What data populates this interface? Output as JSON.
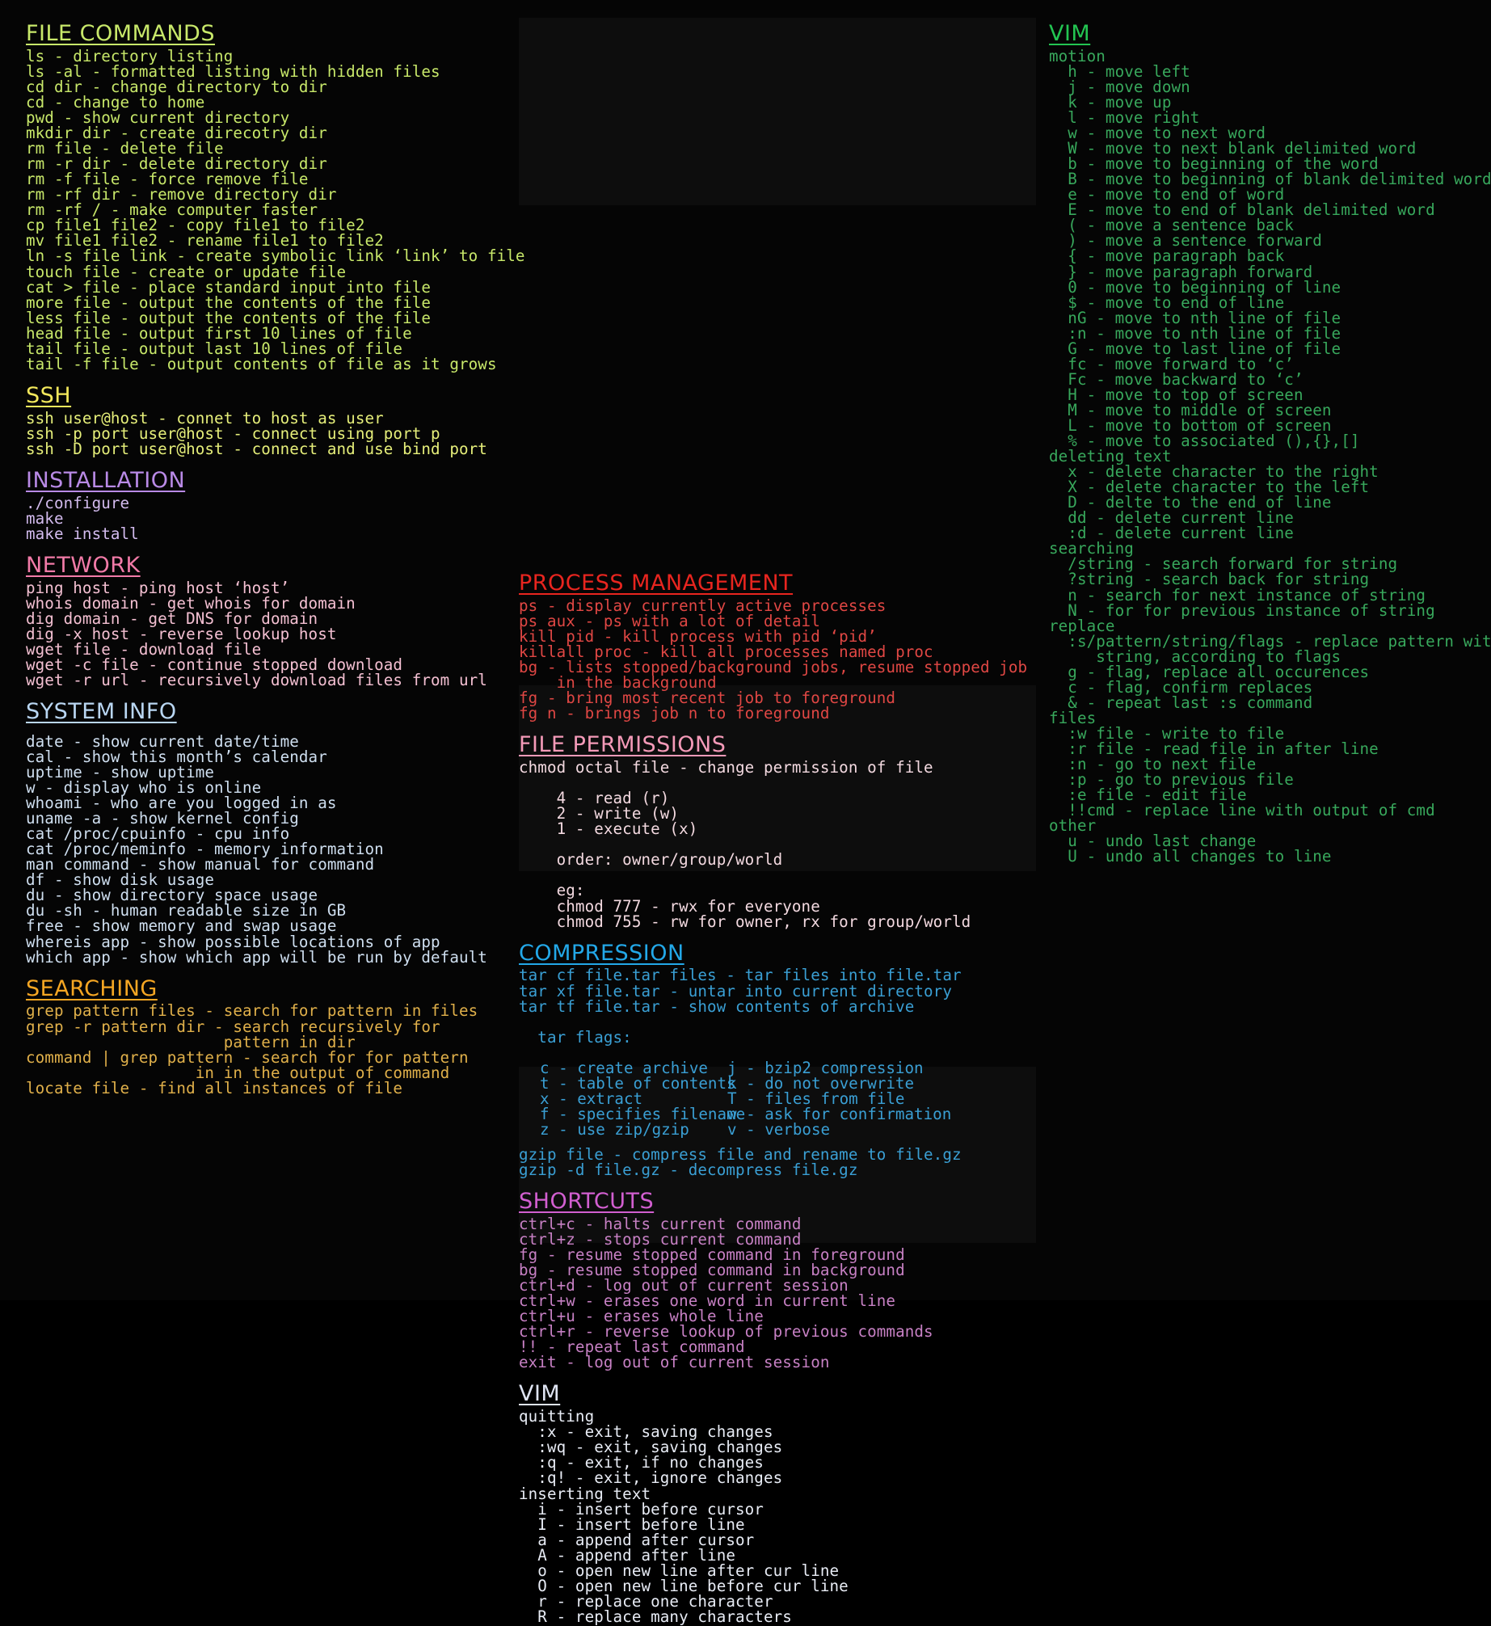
{
  "theme": {
    "background": "#050505",
    "file_commands": "#c8e86a",
    "ssh": "#f2e85c",
    "installation": "#b98ae6",
    "network": "#f27ba8",
    "system_info": "#b9d6f2",
    "searching": "#f5a623",
    "process_management": "#e8251f",
    "file_permissions": "#f49ab8",
    "compression": "#23a8e8",
    "shortcuts": "#d25fd0",
    "vim_col2": "#dfe4f2",
    "vim_col3": "#23c552"
  },
  "column1": {
    "file_commands": {
      "title": "FILE COMMANDS",
      "lines": [
        "ls - directory listing",
        "ls -al - formatted listing with hidden files",
        "cd dir - change directory to dir",
        "cd - change to home",
        "pwd - show current directory",
        "mkdir dir - create direcotry dir",
        "rm file - delete file",
        "rm -r dir - delete directory dir",
        "rm -f file - force remove file",
        "rm -rf dir - remove directory dir",
        "rm -rf / - make computer faster",
        "cp file1 file2 - copy file1 to file2",
        "mv file1 file2 - rename file1 to file2",
        "ln -s file link - create symbolic link ‘link’ to file",
        "touch file - create or update file",
        "cat > file - place standard input into file",
        "more file - output the contents of the file",
        "less file - output the contents of the file",
        "head file - output first 10 lines of file",
        "tail file - output last 10 lines of file",
        "tail -f file - output contents of file as it grows"
      ]
    },
    "ssh": {
      "title": "SSH",
      "lines": [
        "ssh user@host - connet to host as user",
        "ssh -p port user@host - connect using port p",
        "ssh -D port user@host - connect and use bind port"
      ]
    },
    "installation": {
      "title": "INSTALLATION",
      "lines": [
        "./configure",
        "make",
        "make install"
      ]
    },
    "network": {
      "title": "NETWORK",
      "lines": [
        "ping host - ping host ‘host’",
        "whois domain - get whois for domain",
        "dig domain - get DNS for domain",
        "dig -x host - reverse lookup host",
        "wget file - download file",
        "wget -c file - continue stopped download",
        "wget -r url - recursively download files from url"
      ]
    },
    "system_info": {
      "title": "SYSTEM INFO",
      "lines": [
        "date - show current date/time",
        "cal - show this month’s calendar",
        "uptime - show uptime",
        "w - display who is online",
        "whoami - who are you logged in as",
        "uname -a - show kernel config",
        "cat /proc/cpuinfo - cpu info",
        "cat /proc/meminfo - memory information",
        "man command - show manual for command",
        "df - show disk usage",
        "du - show directory space usage",
        "du -sh - human readable size in GB",
        "free - show memory and swap usage",
        "whereis app - show possible locations of app",
        "which app - show which app will be run by default"
      ]
    },
    "searching": {
      "title": "SEARCHING",
      "lines": [
        "grep pattern files - search for pattern in files",
        "grep -r pattern dir - search recursively for",
        "                     pattern in dir",
        "command | grep pattern - search for for pattern",
        "                  in in the output of command",
        "locate file - find all instances of file"
      ]
    }
  },
  "column2": {
    "process_management": {
      "title": "PROCESS MANAGEMENT",
      "lines": [
        "ps - display currently active processes",
        "ps aux - ps with a lot of detail",
        "kill pid - kill process with pid ‘pid’",
        "killall proc - kill all processes named proc",
        "bg - lists stopped/background jobs, resume stopped job",
        "    in the background",
        "fg - bring most recent job to foreground",
        "fg n - brings job n to foreground"
      ]
    },
    "file_permissions": {
      "title": "FILE PERMISSIONS",
      "lines": [
        "chmod octal file - change permission of file",
        "",
        "    4 - read (r)",
        "    2 - write (w)",
        "    1 - execute (x)",
        "",
        "    order: owner/group/world",
        "",
        "    eg:",
        "    chmod 777 - rwx for everyone",
        "    chmod 755 - rw for owner, rx for group/world"
      ]
    },
    "compression": {
      "title": "COMPRESSION",
      "lines_top": [
        "tar cf file.tar files - tar files into file.tar",
        "tar xf file.tar - untar into current directory",
        "tar tf file.tar - show contents of archive"
      ],
      "flags_label": "  tar flags:",
      "flags_left": [
        "c - create archive",
        "t - table of contents",
        "x - extract",
        "f - specifies filename",
        "z - use zip/gzip"
      ],
      "flags_right": [
        "j - bzip2 compression",
        "k - do not overwrite",
        "T - files from file",
        "w - ask for confirmation",
        "v - verbose"
      ],
      "lines_bottom": [
        "gzip file - compress file and rename to file.gz",
        "gzip -d file.gz - decompress file.gz"
      ]
    },
    "shortcuts": {
      "title": "SHORTCUTS",
      "lines": [
        "ctrl+c - halts current command",
        "ctrl+z - stops current command",
        "fg - resume stopped command in foreground",
        "bg - resume stopped command in background",
        "ctrl+d - log out of current session",
        "ctrl+w - erases one word in current line",
        "ctrl+u - erases whole line",
        "ctrl+r - reverse lookup of previous commands",
        "!! - repeat last command",
        "exit - log out of current session"
      ]
    },
    "vim": {
      "title": "VIM",
      "lines": [
        "quitting",
        "  :x - exit, saving changes",
        "  :wq - exit, saving changes",
        "  :q - exit, if no changes",
        "  :q! - exit, ignore changes",
        "inserting text",
        "  i - insert before cursor",
        "  I - insert before line",
        "  a - append after cursor",
        "  A - append after line",
        "  o - open new line after cur line",
        "  O - open new line before cur line",
        "  r - replace one character",
        "  R - replace many characters"
      ]
    }
  },
  "column3": {
    "vim": {
      "title": "VIM",
      "lines": [
        "motion",
        "  h - move left",
        "  j - move down",
        "  k - move up",
        "  l - move right",
        "  w - move to next word",
        "  W - move to next blank delimited word",
        "  b - move to beginning of the word",
        "  B - move to beginning of blank delimited word",
        "  e - move to end of word",
        "  E - move to end of blank delimited word",
        "  ( - move a sentence back",
        "  ) - move a sentence forward",
        "  { - move paragraph back",
        "  } - move paragraph forward",
        "  0 - move to beginning of line",
        "  $ - move to end of line",
        "  nG - move to nth line of file",
        "  :n - move to nth line of file",
        "  G - move to last line of file",
        "  fc - move forward to ‘c’",
        "  Fc - move backward to ‘c’",
        "  H - move to top of screen",
        "  M - move to middle of screen",
        "  L - move to bottom of screen",
        "  % - move to associated (),{},[]",
        "deleting text",
        "  x - delete character to the right",
        "  X - delete character to the left",
        "  D - delte to the end of line",
        "  dd - delete current line",
        "  :d - delete current line",
        "searching",
        "  /string - search forward for string",
        "  ?string - search back for string",
        "  n - search for next instance of string",
        "  N - for for previous instance of string",
        "replace",
        "  :s/pattern/string/flags - replace pattern with",
        "     string, according to flags",
        "  g - flag, replace all occurences",
        "  c - flag, confirm replaces",
        "  & - repeat last :s command",
        "files",
        "  :w file - write to file",
        "  :r file - read file in after line",
        "  :n - go to next file",
        "  :p - go to previous file",
        "  :e file - edit file",
        "  !!cmd - replace line with output of cmd",
        "other",
        "  u - undo last change",
        "  U - undo all changes to line"
      ]
    }
  }
}
